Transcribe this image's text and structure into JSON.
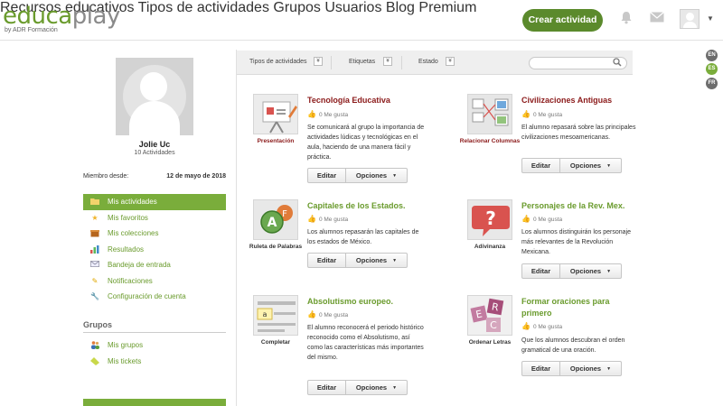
{
  "logo": {
    "main_a": "educa",
    "main_b": "play",
    "sub": "by ADR Formación"
  },
  "nav": [
    "Recursos educativos",
    "Tipos de actividades",
    "Grupos",
    "Usuarios",
    "Blog",
    "Premium"
  ],
  "create_button": "Crear actividad",
  "languages": [
    "EN",
    "ES",
    "FR"
  ],
  "profile": {
    "name": "Jolie Uc",
    "activities": "10 Actividades",
    "member_label": "Miembro desde:",
    "member_date": "12 de mayo de 2018"
  },
  "menu": [
    {
      "label": "Mis actividades",
      "icon": "folder-icon",
      "active": true
    },
    {
      "label": "Mis favoritos",
      "icon": "star-icon"
    },
    {
      "label": "Mis colecciones",
      "icon": "box-icon"
    },
    {
      "label": "Resultados",
      "icon": "chart-icon"
    },
    {
      "label": "Bandeja de entrada",
      "icon": "envelope-icon"
    },
    {
      "label": "Notificaciones",
      "icon": "pencil-icon"
    },
    {
      "label": "Configuración de cuenta",
      "icon": "wrench-icon"
    }
  ],
  "groups": {
    "title": "Grupos",
    "items": [
      {
        "label": "Mis grupos",
        "icon": "people-icon"
      },
      {
        "label": "Mis tickets",
        "icon": "ticket-icon"
      }
    ]
  },
  "filters": [
    "Tipos de actividades",
    "Etiquetas",
    "Estado"
  ],
  "buttons": {
    "edit": "Editar",
    "options": "Opciones"
  },
  "activities": [
    {
      "title": "Tecnología Educativa",
      "type_label": "Presentación",
      "likes": "0 Me gusta",
      "description": "Se comunicará al grupo la importancia de actividades lúdicas y tecnológicas en el aula, haciendo de una manera fácil y práctica.",
      "accent": "#8b1a1a"
    },
    {
      "title": "Civilizaciones Antiguas",
      "type_label": "Relacionar Columnas",
      "likes": "0 Me gusta",
      "description": "El alumno repasará sobre las principales civilizaciones mesoamericanas.",
      "accent": "#8b1a1a"
    },
    {
      "title": "Capitales de los Estados.",
      "type_label": "Ruleta de Palabras",
      "likes": "0 Me gusta",
      "description": "Los alumnos repasarán las capitales de los estados de México.",
      "accent": "#6a9b2d"
    },
    {
      "title": "Personajes de la Rev. Mex.",
      "type_label": "Adivinanza",
      "likes": "0 Me gusta",
      "description": "Los alumnos distinguirán los personaje más relevantes de la Revolución Mexicana.",
      "accent": "#6a9b2d"
    },
    {
      "title": "Absolutismo europeo.",
      "type_label": "Completar",
      "likes": "0 Me gusta",
      "description": "El alumno reconocerá el periodo histórico reconocido como el Absolutismo, así como las características más importantes del mismo.",
      "accent": "#6a9b2d"
    },
    {
      "title": "Formar oraciones para primero",
      "type_label": "Ordenar Letras",
      "likes": "0 Me gusta",
      "description": "Que los alumnos descubran el orden gramatical de una oración.",
      "accent": "#6a9b2d"
    }
  ],
  "colors": {
    "green": "#6a9b2d",
    "active_green": "#7aad3b",
    "dark_red": "#8b1a1a",
    "button_green": "#5b8a2c"
  }
}
